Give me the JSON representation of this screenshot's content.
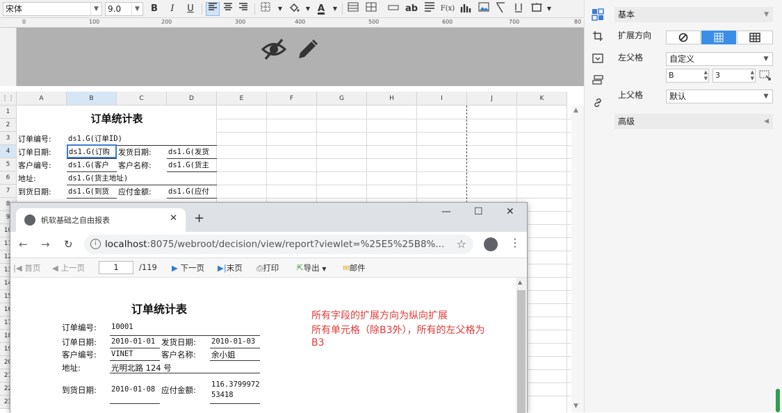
{
  "toolbar": {
    "font_name": "宋体",
    "font_size": "9.0",
    "bold": "B",
    "italic": "I",
    "underline": "U",
    "text_label": "ab",
    "formula_label": "F(x)",
    "font_color": "A"
  },
  "ruler": {
    "labels": [
      "0",
      "100",
      "200",
      "300",
      "400",
      "500",
      "600",
      "700",
      "80"
    ]
  },
  "grid": {
    "columns": [
      "A",
      "B",
      "C",
      "D",
      "E",
      "F",
      "G",
      "H",
      "I",
      "J",
      "K"
    ],
    "rows": [
      "1",
      "2",
      "3",
      "4",
      "5",
      "6",
      "7",
      "8",
      "9",
      "10",
      "11",
      "12",
      "13",
      "14",
      "15",
      "16",
      "17",
      "18",
      "19",
      "20",
      "21",
      "22",
      "23"
    ],
    "cells": {
      "title": "订单统计表",
      "a3": "订单编号:",
      "b3": "ds1.G(订单ID)",
      "a4": "订单日期:",
      "b4": "ds1.G(订购",
      "c4": "发货日期:",
      "d4": "ds1.G(发货",
      "a5": "客户编号:",
      "b5": "ds1.G(客户",
      "c5": "客户名称:",
      "d5": "ds1.G(货主",
      "a6": "地址:",
      "b6": "ds1.G(货主地址)",
      "a7": "到货日期:",
      "b7": "ds1.G(到货",
      "c7": "应付金额:",
      "d7": "ds1.G(应付"
    }
  },
  "panel": {
    "section_basic": "基本",
    "expand_label": "扩展方向",
    "expand_options": [
      "⊘",
      "▦",
      "▦"
    ],
    "left_parent_label": "左父格",
    "left_parent_value": "自定义",
    "left_parent_col": "B",
    "left_parent_row": "3",
    "top_parent_label": "上父格",
    "top_parent_value": "默认",
    "section_advanced": "高级"
  },
  "browser": {
    "tab_title": "帆软基础之自由报表",
    "url_host": "localhost",
    "url_rest": ":8075/webroot/decision/view/report?viewlet=%25E5%25B8%...",
    "report_toolbar": {
      "first": "首页",
      "prev": "上一页",
      "page_value": "1",
      "page_total": "/119",
      "next": "下一页",
      "last": "末页",
      "print": "打印",
      "export": "导出",
      "mail": "邮件"
    },
    "report": {
      "title": "订单统计表",
      "order_id_label": "订单编号:",
      "order_id": "10001",
      "order_date_label": "订单日期:",
      "order_date": "2010-01-01",
      "ship_date_label": "发货日期:",
      "ship_date": "2010-01-03",
      "cust_id_label": "客户编号:",
      "cust_id": "VINET",
      "cust_name_label": "客户名称:",
      "cust_name": "余小姐",
      "address_label": "地址:",
      "address": "光明北路 124 号",
      "arrive_label": "到货日期:",
      "arrive_date": "2010-01-08",
      "amount_label": "应付金额:",
      "amount_line1": "116.3799972",
      "amount_line2": "53418"
    },
    "note_lines": [
      "所有字段的扩展方向为纵向扩展",
      "所有单元格（除B3外），所有的左父格为",
      "B3"
    ]
  }
}
